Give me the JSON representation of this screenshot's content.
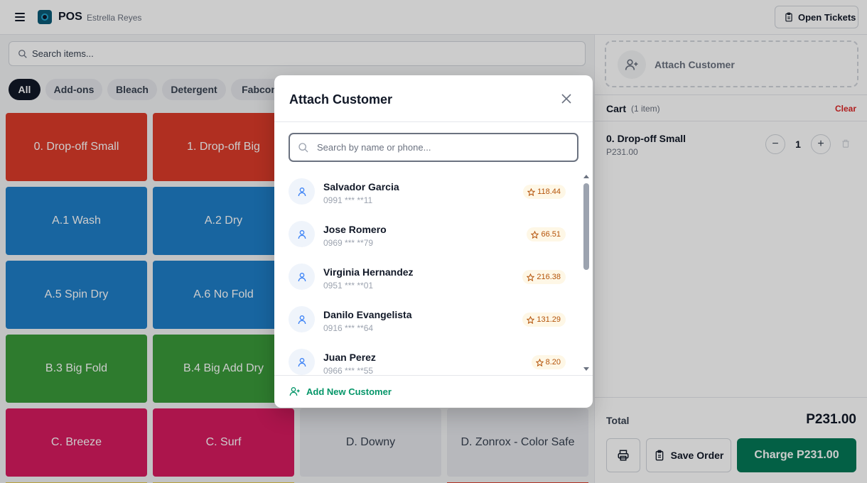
{
  "header": {
    "title": "POS",
    "user": "Estrella Reyes",
    "open_tickets_label": "Open Tickets",
    "menu_icon": "hamburger-icon",
    "logo_icon": "app-logo"
  },
  "search": {
    "placeholder": "Search items..."
  },
  "categories": [
    {
      "label": "All",
      "active": true
    },
    {
      "label": "Add-ons",
      "active": false
    },
    {
      "label": "Bleach",
      "active": false
    },
    {
      "label": "Detergent",
      "active": false
    },
    {
      "label": "Fabcon",
      "active": false
    }
  ],
  "items": [
    {
      "label": "0. Drop-off Small",
      "color": "#dc3b2a"
    },
    {
      "label": "1. Drop-off Big",
      "color": "#dc3b2a"
    },
    {
      "label": "A.1 Wash",
      "color": "#1f7fc9"
    },
    {
      "label": "A.2 Dry",
      "color": "#1f7fc9"
    },
    {
      "label": "A.5 Spin Dry",
      "color": "#1f7fc9"
    },
    {
      "label": "A.6 No Fold",
      "color": "#1f7fc9"
    },
    {
      "label": "B.3 Big Fold",
      "color": "#3a9a3a"
    },
    {
      "label": "B.4 Big Add Dry",
      "color": "#3a9a3a"
    },
    {
      "label": "C. Breeze",
      "color": "#d81b5f"
    },
    {
      "label": "C. Surf",
      "color": "#d81b5f"
    },
    {
      "label": "D. Downy",
      "color": "#d1d5db"
    },
    {
      "label": "D. Zonrox - Color Safe",
      "color": "#d1d5db"
    }
  ],
  "attach_panel": {
    "label": "Attach Customer"
  },
  "cart": {
    "title": "Cart",
    "count": "(1 item)",
    "clear_label": "Clear",
    "items": [
      {
        "name": "0. Drop-off Small",
        "price": "P231.00",
        "qty": "1"
      }
    ],
    "total_label": "Total",
    "total": "P231.00",
    "save_label": "Save Order",
    "charge_label": "Charge P231.00"
  },
  "modal": {
    "title": "Attach Customer",
    "search_placeholder": "Search by name or phone...",
    "customers": [
      {
        "name": "Salvador Garcia",
        "phone": "0991 *** **11",
        "points": "118.44"
      },
      {
        "name": "Jose Romero",
        "phone": "0969 *** **79",
        "points": "66.51"
      },
      {
        "name": "Virginia Hernandez",
        "phone": "0951 *** **01",
        "points": "216.38"
      },
      {
        "name": "Danilo Evangelista",
        "phone": "0916 *** **64",
        "points": "131.29"
      },
      {
        "name": "Juan Perez",
        "phone": "0966 *** **55",
        "points": "8.20"
      }
    ],
    "add_new_label": "Add New Customer"
  },
  "colors": {
    "accent_green": "#047857",
    "clear_red": "#dc2626",
    "points_text": "#b45309"
  }
}
